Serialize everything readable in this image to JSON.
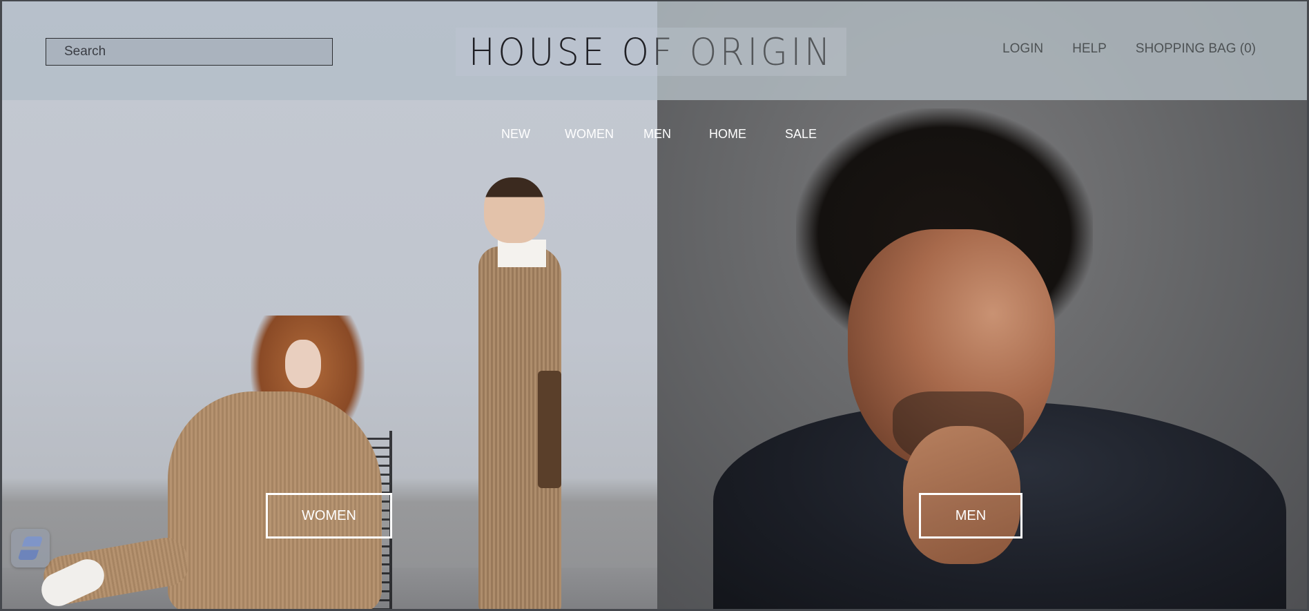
{
  "header": {
    "search_placeholder": "Search",
    "logo_text": "HOUSE OF ORIGIN",
    "links": {
      "login": "LOGIN",
      "help": "HELP",
      "shopping_bag": "SHOPPING BAG (0)"
    }
  },
  "nav": {
    "new": "NEW",
    "women": "WOMEN",
    "men": "MEN",
    "home": "HOME",
    "sale": "SALE"
  },
  "hero": {
    "women_button": "WOMEN",
    "men_button": "MEN"
  },
  "widget": {
    "icon": "app-logo-icon"
  }
}
